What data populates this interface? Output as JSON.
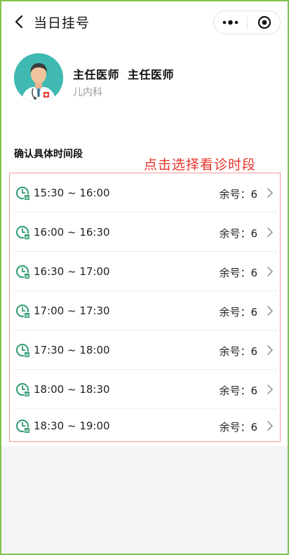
{
  "navbar": {
    "title": "当日挂号"
  },
  "doctor": {
    "title_1": "主任医师",
    "title_2": "主任医师",
    "department": "儿内科"
  },
  "section": {
    "title": "确认具体时间段",
    "hint": "点击选择看诊时段"
  },
  "slots": [
    {
      "time": "15:30 ~ 16:00",
      "remain": "余号：6"
    },
    {
      "time": "16:00 ~ 16:30",
      "remain": "余号：6"
    },
    {
      "time": "16:30 ~ 17:00",
      "remain": "余号：6"
    },
    {
      "time": "17:00 ~ 17:30",
      "remain": "余号：6"
    },
    {
      "time": "17:30 ~ 18:00",
      "remain": "余号：6"
    },
    {
      "time": "18:00 ~ 18:30",
      "remain": "余号：6"
    },
    {
      "time": "18:30 ~ 19:00",
      "remain": "余号：6"
    }
  ],
  "colors": {
    "accent_green": "#2e9b6f",
    "hint_red": "#e8332a",
    "frame_green": "#7fc24e"
  },
  "icons": {
    "back": "chevron-left-icon",
    "more": "more-dots-icon",
    "close": "target-circle-icon",
    "slot": "clock-calendar-icon",
    "row_arrow": "chevron-right-icon"
  }
}
